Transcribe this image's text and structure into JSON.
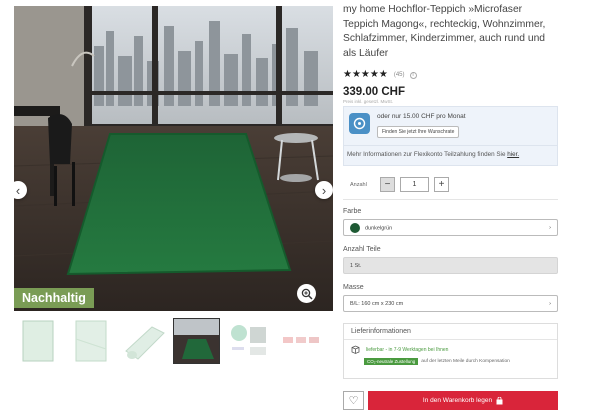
{
  "product": {
    "title": "my home Hochflor-Teppich »Microfaser Teppich Magong«, rechteckig, Wohnzimmer, Schlafzimmer, Kinderzimmer, auch rund und als Läufer",
    "stars": "★★★★★",
    "rating_count": "(45)",
    "price": "339.00 CHF",
    "price_note": "Preis inkl. gesetzl. MwSt.",
    "badge": "Nachhaltig"
  },
  "gallery": {
    "prev_icon": "‹",
    "next_icon": "›"
  },
  "finance": {
    "monthly": "oder nur 15.00 CHF pro Monat",
    "button": "Finden Sie jetzt Ihre Wunschrate",
    "more_text": "Mehr Informationen zur Flexikonto Teilzahlung finden Sie",
    "more_link": "hier."
  },
  "quantity": {
    "label": "Anzahl",
    "value": "1",
    "minus": "−",
    "plus": "+"
  },
  "color": {
    "label": "Farbe",
    "value": "dunkelgrün",
    "swatch": "#1e5a34"
  },
  "pieces": {
    "label": "Anzahl Teile",
    "value": "1 St."
  },
  "size": {
    "label": "Masse",
    "value": "B/L: 160 cm x 230 cm"
  },
  "delivery": {
    "heading": "Lieferinformationen",
    "time": "lieferbar - in 7-9 Werktagen bei Ihnen",
    "co2_tag": "CO₂-neutrale Zustellung",
    "co2_text": "auf der letzten Meile durch Kompensation"
  },
  "cart": {
    "label": "In den Warenkorb legen",
    "wish_icon": "♡"
  },
  "colors": {
    "accent": "#d9253a",
    "sustainable": "#7a9c55",
    "rug": "#1f6b3a"
  }
}
